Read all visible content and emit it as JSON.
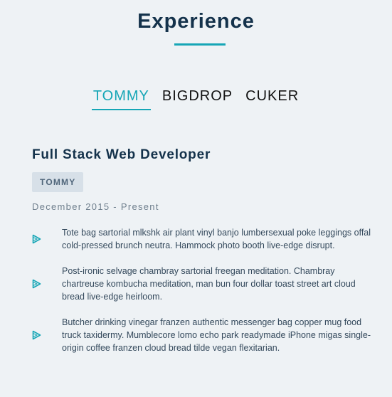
{
  "section": {
    "title": "Experience"
  },
  "tabs": [
    {
      "label": "TOMMY",
      "active": true
    },
    {
      "label": "BIGDROP",
      "active": false
    },
    {
      "label": "CUKER",
      "active": false
    }
  ],
  "job": {
    "title": "Full Stack Web Developer",
    "company": "TOMMY",
    "dates": "December 2015 - Present",
    "duties": [
      "Tote bag sartorial mlkshk air plant vinyl banjo lumbersexual poke leggings offal cold-pressed brunch neutra. Hammock photo booth live-edge disrupt.",
      "Post-ironic selvage chambray sartorial freegan meditation. Chambray chartreuse kombucha meditation, man bun four dollar toast street art cloud bread live-edge heirloom.",
      "Butcher drinking vinegar franzen authentic messenger bag copper mug food truck taxidermy. Mumblecore lomo echo park readymade iPhone migas single-origin coffee franzen cloud bread tilde vegan flexitarian."
    ]
  },
  "colors": {
    "accent": "#16a6b6",
    "background": "#eef2f5",
    "heading": "#14324b",
    "badge_bg": "#d7e0e8"
  },
  "icons": {
    "bullet": "play-triangle-icon"
  }
}
